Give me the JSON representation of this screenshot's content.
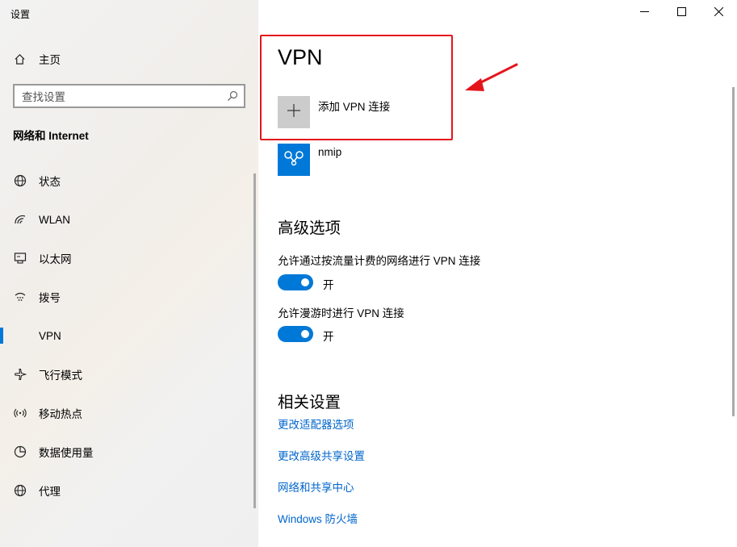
{
  "window": {
    "title": "设置",
    "controls": {
      "minimize": "minimize-icon",
      "maximize": "maximize-icon",
      "close": "close-icon"
    }
  },
  "sidebar": {
    "home_label": "主页",
    "search_placeholder": "查找设置",
    "section_title": "网络和 Internet",
    "items": [
      {
        "label": "状态",
        "icon": "globe-status-icon"
      },
      {
        "label": "WLAN",
        "icon": "wifi-icon"
      },
      {
        "label": "以太网",
        "icon": "ethernet-icon"
      },
      {
        "label": "拨号",
        "icon": "dialup-icon"
      },
      {
        "label": "VPN",
        "icon": "vpn-icon",
        "active": true
      },
      {
        "label": "飞行模式",
        "icon": "airplane-icon"
      },
      {
        "label": "移动热点",
        "icon": "hotspot-icon"
      },
      {
        "label": "数据使用量",
        "icon": "data-usage-icon"
      },
      {
        "label": "代理",
        "icon": "proxy-globe-icon"
      }
    ]
  },
  "main": {
    "title": "VPN",
    "add_vpn_label": "添加 VPN 连接",
    "connections": [
      {
        "name": "nmip",
        "icon": "vpn-connection-icon"
      }
    ],
    "advanced": {
      "title": "高级选项",
      "options": [
        {
          "label": "允许通过按流量计费的网络进行 VPN 连接",
          "state": "开",
          "on": true
        },
        {
          "label": "允许漫游时进行 VPN 连接",
          "state": "开",
          "on": true
        }
      ]
    },
    "related": {
      "title": "相关设置",
      "links": [
        "更改适配器选项",
        "更改高级共享设置",
        "网络和共享中心",
        "Windows 防火墙"
      ]
    }
  },
  "colors": {
    "accent": "#0078d7",
    "annotation": "#e4141b",
    "link": "#0066cc"
  }
}
